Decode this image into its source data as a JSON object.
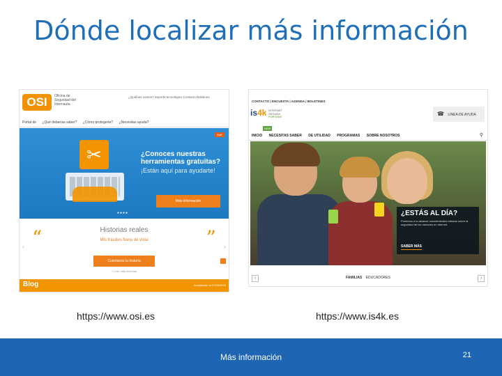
{
  "slide": {
    "title": "Dónde localizar más información",
    "page_number": "21",
    "footer_text": "Más información"
  },
  "links": {
    "osi_url": "https://www.osi.es",
    "is4k_url": "https://www.is4k.es"
  },
  "osi_site": {
    "logo": "OSI",
    "logo_subtitle": "Oficina de Seguridad del Internauta",
    "top_links": "¿Quiénes somos?  Soporte tecnológico  Contacto  Boletines",
    "nav": [
      "Portal de",
      "¿Qué deberías saber?",
      "¿Cómo protegerte?",
      "¿Necesitas ayuda?"
    ],
    "hero_badge": "SAE",
    "hero_title": "¿Conoces nuestras herramientas gratuitas?",
    "hero_subtitle": "¡Están aquí para ayudarte!",
    "hero_button": "Más información",
    "stories_title": "Historias reales",
    "stories_subtitle": "Mis fraudes fuera de vista",
    "stories_button": "Cuéntanos tu historia",
    "stories_more": "+ Leer más historias",
    "blog_label": "Blog",
    "blog_date": "Actualizado el 07/06/2016"
  },
  "is4k_site": {
    "top_links": "CONTACTO | ENCUESTA | AGENDA | BOLETINES",
    "logo_main": "is",
    "logo_four": "4k",
    "logo_tag_1": "INTERNET",
    "logo_tag_2": "SEGURA",
    "logo_tag_3": "FOR KIDS",
    "help_label": "LÍNEA DE AYUDA",
    "new_badge": "NEW",
    "nav": [
      "INICIO",
      "NECESITAS SABER",
      "DE UTILIDAD",
      "PROGRAMAS",
      "SOBRE NOSOTROS"
    ],
    "overlay_title": "¿ESTÁS AL DÍA?",
    "overlay_text": "Ponemos a tu alcance conocimientos básicos sobre la seguridad de los menores en Internet.",
    "overlay_button": "SABER MÁS",
    "bottom_primary": "FAMILIAS",
    "bottom_secondary": "EDUCADORES"
  },
  "colors": {
    "title_blue": "#1f6fb8",
    "footer_blue": "#1e66b4",
    "osi_orange": "#f29400",
    "osi_blue": "#2f8fd6"
  }
}
